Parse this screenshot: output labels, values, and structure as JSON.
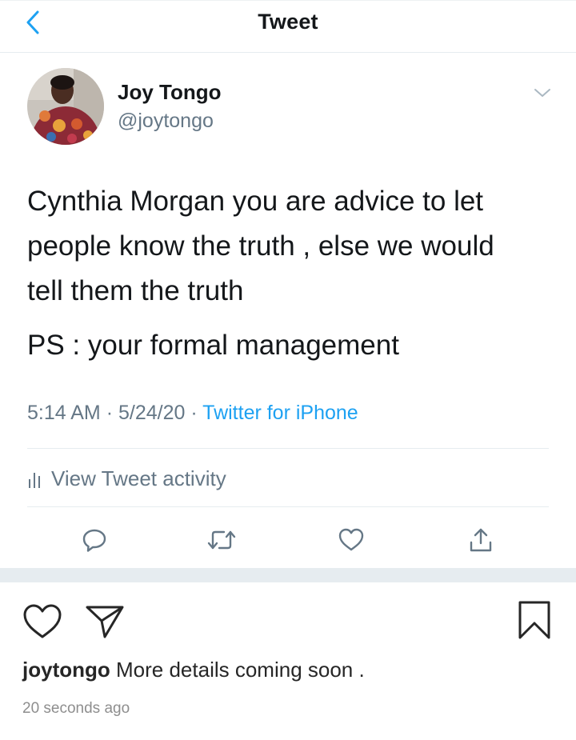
{
  "header": {
    "title": "Tweet",
    "back_icon": "chevron-left-icon",
    "accent_color": "#1da1f2"
  },
  "tweet": {
    "author": {
      "display_name": "Joy Tongo",
      "handle": "@joytongo"
    },
    "caret_icon": "chevron-down-icon",
    "text_lines": [
      "Cynthia Morgan you are advice to let",
      "people know the truth , else we would",
      "tell them the truth"
    ],
    "ps_line": "PS : your formal management",
    "time": "5:14 AM",
    "date": "5/24/20",
    "separator": "·",
    "source": "Twitter for iPhone",
    "activity_label": "View Tweet activity",
    "actions": [
      "reply-icon",
      "retweet-icon",
      "like-icon",
      "share-icon"
    ]
  },
  "instagram": {
    "actions": [
      "heart-icon",
      "direct-send-icon",
      "bookmark-icon"
    ],
    "caption_user": "joytongo",
    "caption_text": "More details coming soon .",
    "time_ago": "20 seconds ago"
  }
}
